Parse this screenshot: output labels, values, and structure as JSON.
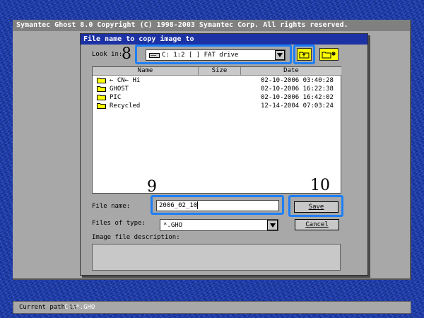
{
  "app": {
    "title": "Symantec Ghost 8.0   Copyright (C) 1998-2003 Symantec Corp. All rights reserved."
  },
  "dialog": {
    "title": "File name to copy image to",
    "look_in_label": "Look in:",
    "look_in_value": "C: 1:2 [ ] FAT drive",
    "columns": [
      "Name",
      "Size",
      "Date"
    ],
    "files": [
      {
        "name": "← CN← Hi",
        "size": "",
        "date": "02-10-2006 03:40:28"
      },
      {
        "name": "GHOST",
        "size": "",
        "date": "02-10-2006 16:22:38"
      },
      {
        "name": "PIC",
        "size": "",
        "date": "02-10-2006 16:42:02"
      },
      {
        "name": "Recycled",
        "size": "",
        "date": "12-14-2004 07:03:24"
      }
    ],
    "file_name_label": "File name:",
    "file_name_value": "2006_02_10",
    "files_of_type_label": "Files of type:",
    "files_of_type_value": "*.GHO",
    "save_label": "Save",
    "cancel_label": "Cancel",
    "description_label": "Image file description:"
  },
  "annotations": {
    "look_in": "8",
    "file_name": "9",
    "save": "10"
  },
  "status": {
    "label": "Current path is",
    "path": "C:\\*.GHO"
  },
  "colors": {
    "highlight": "#1e7ff5",
    "dialog_title_bar": "#1c32a4",
    "folder_icon": "#ffff00"
  },
  "icons": {
    "up_folder": "folder-up-icon",
    "new_folder": "new-folder-icon",
    "drive": "drive-icon",
    "dropdown": "chevron-down-icon",
    "folder": "folder-icon"
  }
}
